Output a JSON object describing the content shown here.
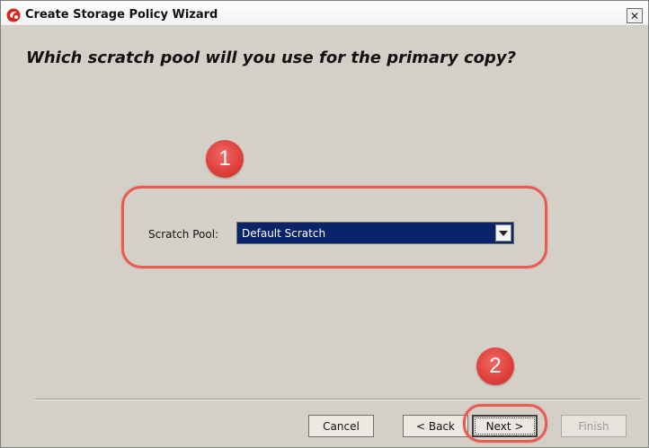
{
  "window": {
    "title": "Create Storage Policy Wizard",
    "close_glyph": "✕"
  },
  "page": {
    "heading": "Which scratch pool will you use for the primary copy?"
  },
  "form": {
    "scratch_pool_label": "Scratch Pool:",
    "scratch_pool_value": "Default Scratch"
  },
  "annotations": {
    "marker_1": "1",
    "marker_2": "2",
    "color": "#e0413d"
  },
  "buttons": {
    "cancel": "Cancel",
    "back": "< Back",
    "next": "Next >",
    "finish": "Finish"
  },
  "icons": {
    "app": "commvault-app-icon",
    "dropdown": "chevron-down-icon",
    "close": "close-icon"
  }
}
